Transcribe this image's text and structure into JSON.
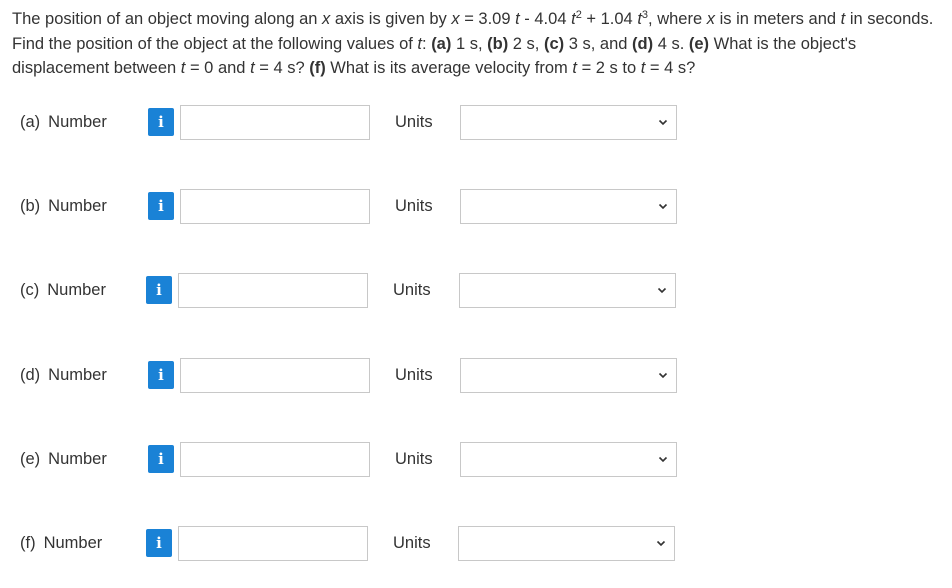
{
  "question": {
    "p1": "The position of an object moving along an ",
    "x1": "x",
    "p2": " axis is given by ",
    "x2": "x",
    "p3": " = 3.09 ",
    "t1": "t",
    "p4": " - 4.04 ",
    "t2": "t",
    "sup2": "2",
    "p5": " + 1.04 ",
    "t3": "t",
    "sup3": "3",
    "p6": ", where ",
    "x3": "x",
    "p7": " is in meters and ",
    "t4": "t",
    "p8": " in seconds. Find the position of the object at the following values of ",
    "t5": "t",
    "p9": ": ",
    "ba": "(a)",
    "p10": " 1 s, ",
    "bb": "(b)",
    "p11": " 2 s, ",
    "bc": "(c)",
    "p12": " 3 s, and ",
    "bd": "(d)",
    "p13": " 4 s. ",
    "be": "(e)",
    "p14": " What is the object's displacement between ",
    "t6": "t",
    "p15": " = 0 and ",
    "t7": "t",
    "p16": " = 4 s? ",
    "bf": "(f)",
    "p17": " What is its average velocity from ",
    "t8": "t",
    "p18": " = 2 s to ",
    "t9": "t",
    "p19": " = 4 s?"
  },
  "parts": [
    {
      "label": "(a)",
      "number_label": "Number",
      "info_icon": "i",
      "value": "",
      "units_label": "Units",
      "units_selected": ""
    },
    {
      "label": "(b)",
      "number_label": "Number",
      "info_icon": "i",
      "value": "",
      "units_label": "Units",
      "units_selected": ""
    },
    {
      "label": "(c)",
      "number_label": "Number",
      "info_icon": "i",
      "value": "",
      "units_label": "Units",
      "units_selected": ""
    },
    {
      "label": "(d)",
      "number_label": "Number",
      "info_icon": "i",
      "value": "",
      "units_label": "Units",
      "units_selected": ""
    },
    {
      "label": "(e)",
      "number_label": "Number",
      "info_icon": "i",
      "value": "",
      "units_label": "Units",
      "units_selected": ""
    },
    {
      "label": "(f)",
      "number_label": "Number",
      "info_icon": "i",
      "value": "",
      "units_label": "Units",
      "units_selected": ""
    }
  ],
  "colors": {
    "info_button": "#1a82d6",
    "border": "#c8c8c8",
    "text": "#333333"
  }
}
